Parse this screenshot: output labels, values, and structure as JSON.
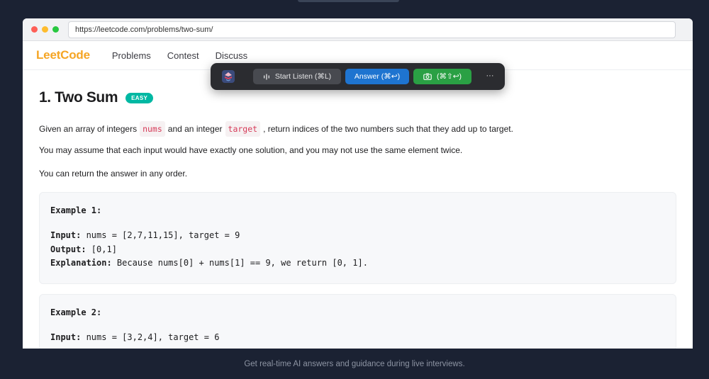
{
  "browser": {
    "url": "https://leetcode.com/problems/two-sum/"
  },
  "site": {
    "logo": "LeetCode",
    "nav": [
      "Problems",
      "Contest",
      "Discuss"
    ]
  },
  "problem": {
    "title": "1. Two Sum",
    "difficulty": "EASY",
    "desc1_pre": "Given an array of integers",
    "desc1_code1": "nums",
    "desc1_mid": "and an integer",
    "desc1_code2": "target",
    "desc1_post": ", return indices of the two numbers such that they add up to target.",
    "desc2": "You may assume that each input would have exactly one solution, and you may not use the same element twice.",
    "desc3": "You can return the answer in any order."
  },
  "examples": [
    {
      "title": "Example 1:",
      "input_label": "Input:",
      "input": " nums = [2,7,11,15], target = 9",
      "output_label": "Output:",
      "output": " [0,1]",
      "explanation_label": "Explanation:",
      "explanation": " Because nums[0] + nums[1] == 9, we return [0, 1]."
    },
    {
      "title": "Example 2:",
      "input_label": "Input:",
      "input": " nums = [3,2,4], target = 6"
    }
  ],
  "toolbar": {
    "listen_label": "Start Listen (⌘L)",
    "answer_label": "Answer (⌘↩)",
    "screenshot_label": "(⌘⇧↩)",
    "more_label": "···",
    "icons": [
      "app-logo-icon",
      "waveform-icon",
      "camera-icon",
      "more-icon"
    ],
    "colors": {
      "answer": "#1e74d0",
      "screenshot": "#2aa044",
      "listen": "#484a50"
    }
  },
  "tagline": "Get real-time AI answers and guidance during live interviews."
}
